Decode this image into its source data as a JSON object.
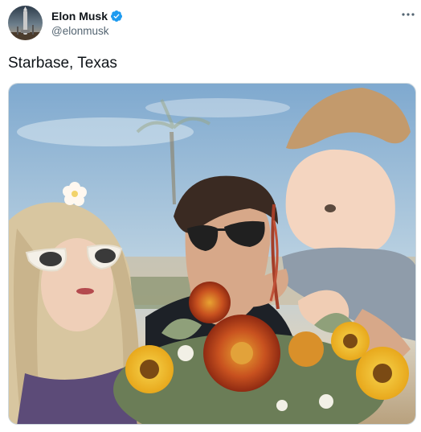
{
  "tweet": {
    "author": {
      "display_name": "Elon Musk",
      "handle": "@elonmusk",
      "verified": true
    },
    "text": "Starbase, Texas",
    "media": {
      "icon": "photo"
    }
  },
  "icons": {
    "avatar": "avatar-rocket-image",
    "verified": "verified-badge-icon",
    "more": "more-dots-icon"
  },
  "colors": {
    "verified_blue": "#1d9bf0",
    "text_primary": "#0f1419",
    "text_secondary": "#536471",
    "border": "#cfd9de"
  }
}
